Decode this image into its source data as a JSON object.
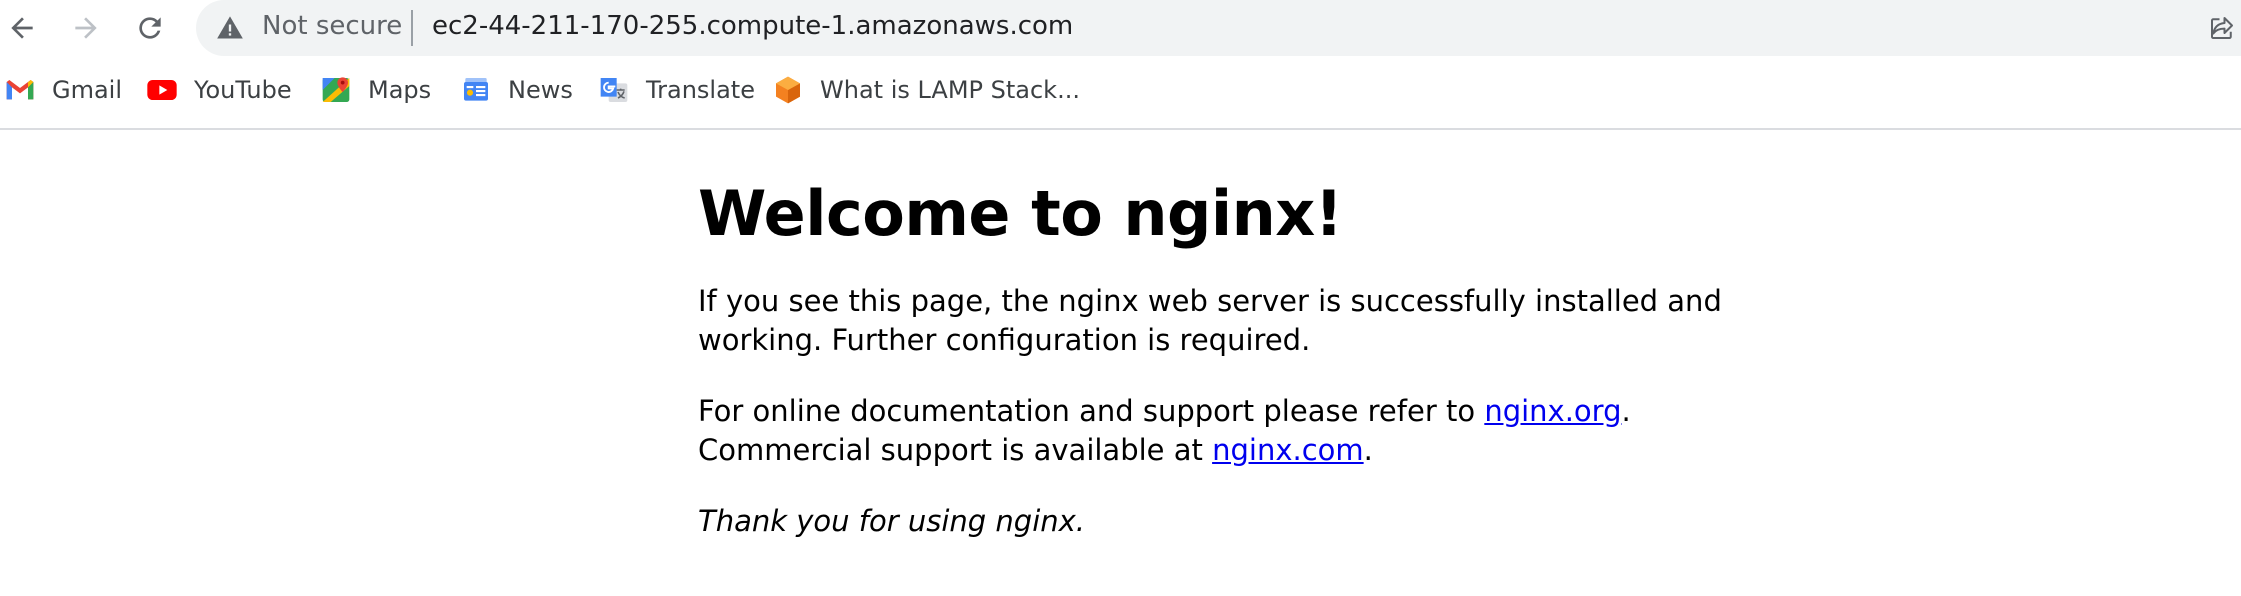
{
  "browser": {
    "security_label": "Not secure",
    "url": "ec2-44-211-170-255.compute-1.amazonaws.com",
    "icons": {
      "back": "arrow-left-icon",
      "forward": "arrow-right-icon",
      "reload": "reload-icon",
      "security": "warning-triangle-icon",
      "share": "share-icon"
    }
  },
  "bookmarks": [
    {
      "label": "Gmail",
      "icon": "gmail-icon"
    },
    {
      "label": "YouTube",
      "icon": "youtube-icon"
    },
    {
      "label": "Maps",
      "icon": "maps-icon"
    },
    {
      "label": "News",
      "icon": "news-icon"
    },
    {
      "label": "Translate",
      "icon": "translate-icon"
    },
    {
      "label": "What is LAMP Stack...",
      "icon": "cube-icon"
    }
  ],
  "page": {
    "heading": "Welcome to nginx!",
    "p1": "If you see this page, the nginx web server is successfully installed and working. Further configuration is required.",
    "p2_before": "For online documentation and support please refer to ",
    "p2_link1": "nginx.org",
    "p2_middle": ". Commercial support is available at ",
    "p2_link2": "nginx.com",
    "p2_after": ".",
    "p3": "Thank you for using nginx."
  }
}
